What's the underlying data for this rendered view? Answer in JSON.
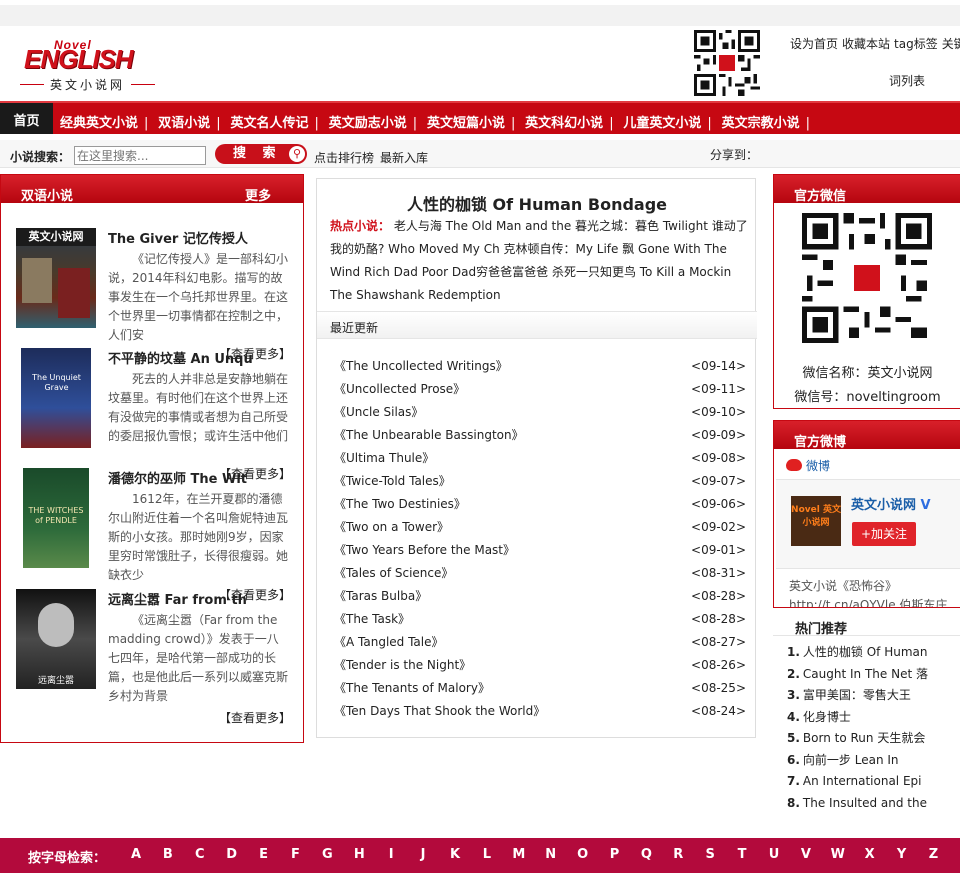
{
  "header": {
    "logo": {
      "novel": "Novel",
      "english": "ENGLISH",
      "cn": "英文小说网"
    },
    "top_links": [
      "设为首页",
      "收藏本站",
      "tag标签",
      "关键"
    ],
    "top_links_second": "词列表"
  },
  "nav": {
    "home": "首页",
    "items": [
      "经典英文小说",
      "双语小说",
      "英文名人传记",
      "英文励志小说",
      "英文短篇小说",
      "英文科幻小说",
      "儿童英文小说",
      "英文宗教小说"
    ],
    "separator": "|"
  },
  "search": {
    "label": "小说搜索：",
    "placeholder": "在这里搜索...",
    "button": "搜 索",
    "link_rank": "点击排行榜",
    "link_new": "最新入库",
    "share": "分享到："
  },
  "left": {
    "title": "双语小说",
    "more": "更多",
    "items": [
      {
        "title": "The Giver 记忆传授人",
        "desc": "《记忆传授人》是一部科幻小说，2014年科幻电影。描写的故事发生在一个乌托邦世界里。在这个世界里一切事情都在控制之中，人们安",
        "more": "【查看更多】",
        "cover_caption": "英文小说网"
      },
      {
        "title": "不平静的坟墓 An Unqu",
        "desc": "死去的人并非总是安静地躺在坟墓里。有时他们在这个世界上还有没做完的事情或者想为自己所受的委屈报仇雪恨；或许生活中他们",
        "more": "【查看更多】",
        "cover_caption": "The Unquiet Grave"
      },
      {
        "title": "潘德尔的巫师 The Wit",
        "desc": "1612年，在兰开夏郡的潘德尔山附近住着一个名叫詹妮特迪瓦斯的小女孩。那时她刚9岁，因家里穷时常饿肚子，长得很瘦弱。她缺衣少",
        "more": "【查看更多】",
        "cover_caption": "THE WITCHES of PENDLE"
      },
      {
        "title": "远离尘嚣 Far from th",
        "desc": "《远离尘嚣（Far from the madding crowd）》发表于一八七四年，是哈代第一部成功的长篇，也是他此后一系列以威塞克斯乡村为背景",
        "more": "【查看更多】",
        "cover_caption": "远离尘嚣"
      }
    ]
  },
  "center": {
    "title": "人性的枷锁 Of Human Bondage",
    "hot_label": "热点小说：",
    "hot_text": "老人与海 The Old Man and the 暮光之城：暮色 Twilight 谁动了我的奶酪? Who Moved My Ch 克林顿自传：My Life 飘 Gone With The Wind Rich Dad Poor Dad穷爸爸富爸爸 杀死一只知更鸟 To Kill a Mockin The Shawshank Redemption",
    "recent_title": "最近更新",
    "recent": [
      {
        "t": "《The Uncollected Writings》",
        "d": "<09-14>"
      },
      {
        "t": "《Uncollected Prose》",
        "d": "<09-11>"
      },
      {
        "t": "《Uncle Silas》",
        "d": "<09-10>"
      },
      {
        "t": "《The Unbearable Bassington》",
        "d": "<09-09>"
      },
      {
        "t": "《Ultima Thule》",
        "d": "<09-08>"
      },
      {
        "t": "《Twice-Told Tales》",
        "d": "<09-07>"
      },
      {
        "t": "《The Two Destinies》",
        "d": "<09-06>"
      },
      {
        "t": "《Two on a Tower》",
        "d": "<09-02>"
      },
      {
        "t": "《Two Years Before the Mast》",
        "d": "<09-01>"
      },
      {
        "t": "《Tales of Science》",
        "d": "<08-31>"
      },
      {
        "t": "《Taras Bulba》",
        "d": "<08-28>"
      },
      {
        "t": "《The Task》",
        "d": "<08-28>"
      },
      {
        "t": "《A Tangled Tale》",
        "d": "<08-27>"
      },
      {
        "t": "《Tender is the Night》",
        "d": "<08-26>"
      },
      {
        "t": "《The Tenants of Malory》",
        "d": "<08-25>"
      },
      {
        "t": "《Ten Days That Shook the World》",
        "d": "<08-24>"
      }
    ]
  },
  "right": {
    "wechat_title": "官方微信",
    "wechat_name": "微信名称：英文小说网",
    "wechat_id": "微信号：noveltingroom",
    "weibo_title": "官方微博",
    "weibo_brand": "微博",
    "weibo_account": "英文小说网",
    "weibo_verified": "V",
    "weibo_follow": "+加关注",
    "weibo_post": "英文小说《恐怖谷》http://t.cn/aQYVle 伯斯东庄园的主人",
    "avatar_text": "Novel 英文小说网",
    "hot_title": "热门推荐",
    "hot_list": [
      "人性的枷锁 Of Human",
      "Caught In The Net 落",
      "富甲美国：零售大王",
      "化身博士",
      "Born to Run 天生就会",
      "向前一步 Lean In",
      "An International Epi",
      "The Insulted and the"
    ]
  },
  "footer": {
    "label": "按字母检索：",
    "letters": [
      "A",
      "B",
      "C",
      "D",
      "E",
      "F",
      "G",
      "H",
      "I",
      "J",
      "K",
      "L",
      "M",
      "N",
      "O",
      "P",
      "Q",
      "R",
      "S",
      "T",
      "U",
      "V",
      "W",
      "X",
      "Y",
      "Z"
    ]
  },
  "colors": {
    "brand_red": "#c60812",
    "footer": "#b30a3c",
    "link_blue": "#1a5ea8"
  }
}
